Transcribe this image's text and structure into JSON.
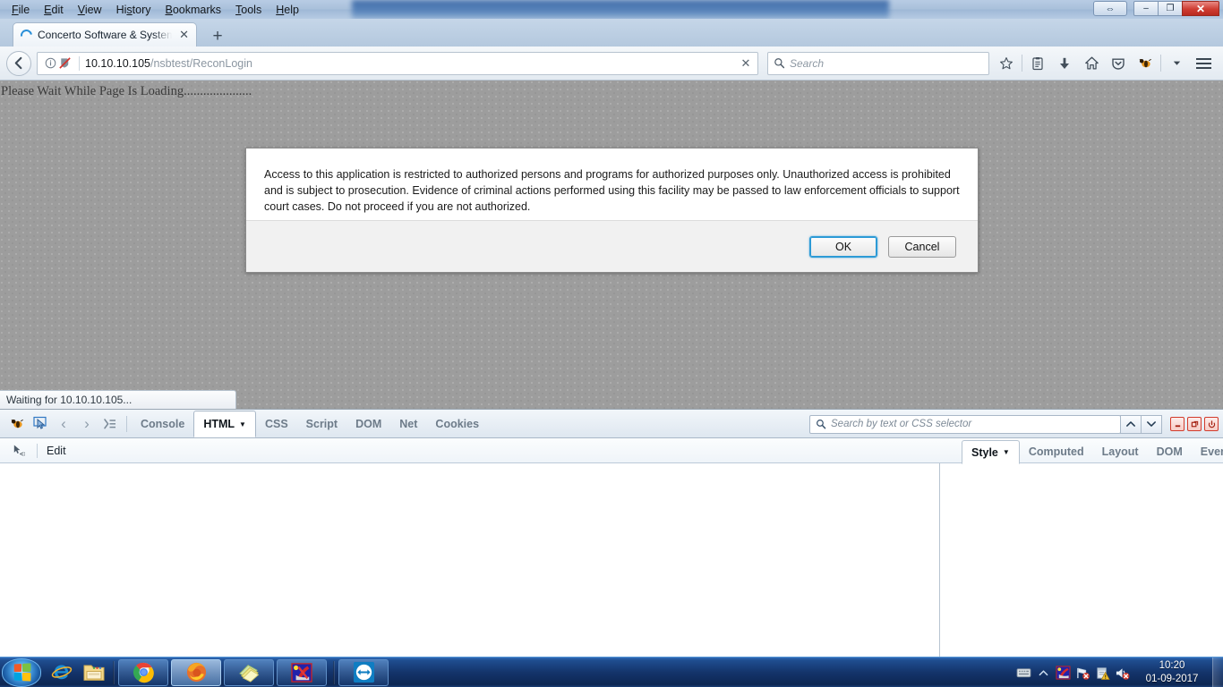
{
  "window": {
    "menus": [
      "File",
      "Edit",
      "View",
      "History",
      "Bookmarks",
      "Tools",
      "Help"
    ],
    "minimize_label": "–",
    "restore_label": "❐",
    "close_label": "✕",
    "teamviewer_label": "⇔",
    "ghost_title": ""
  },
  "tab": {
    "title": "Concerto Software & System",
    "close_label": "✕",
    "newtab_label": "+"
  },
  "navbar": {
    "back_label": "←",
    "url_host": "10.10.10.105",
    "url_path": "/nsbtest/ReconLogin",
    "clear_label": "✕",
    "search_placeholder": "Search",
    "icons": [
      "bookmark-star-icon",
      "reader-list-icon",
      "downloads-icon",
      "home-icon",
      "pocket-icon",
      "firebug-icon",
      "chevron-down-icon",
      "menu-hamburger-icon"
    ]
  },
  "page": {
    "loading_text": "Please Wait While Page Is Loading.....................",
    "status_text": "Waiting for 10.10.10.105..."
  },
  "dialog": {
    "message": "Access to this application is restricted to authorized persons and programs for authorized purposes only. Unauthorized access is prohibited and is subject to prosecution. Evidence of criminal actions performed using this facility may be passed to law enforcement officials to support court cases. Do not proceed if you are not authorized.",
    "ok_label": "OK",
    "cancel_label": "Cancel"
  },
  "firebug": {
    "nav_prev": "‹",
    "nav_next": "›",
    "tabs": [
      {
        "label": "Console",
        "active": false
      },
      {
        "label": "HTML",
        "active": true
      },
      {
        "label": "CSS",
        "active": false
      },
      {
        "label": "Script",
        "active": false
      },
      {
        "label": "DOM",
        "active": false
      },
      {
        "label": "Net",
        "active": false
      },
      {
        "label": "Cookies",
        "active": false
      }
    ],
    "search_placeholder": "Search by text or CSS selector",
    "search_up": "⌃",
    "search_down": "⌄",
    "win_minimize": "–",
    "win_maximize": "❐",
    "win_close": "⏻",
    "edit_label": "Edit",
    "side_tabs": [
      {
        "label": "Style",
        "active": true
      },
      {
        "label": "Computed",
        "active": false
      },
      {
        "label": "Layout",
        "active": false
      },
      {
        "label": "DOM",
        "active": false
      },
      {
        "label": "Events",
        "active": false
      }
    ],
    "more_label": "▶"
  },
  "taskbar": {
    "start_label": "start-orb",
    "quick_launch": [
      "internet-explorer-icon",
      "windows-explorer-icon"
    ],
    "apps": [
      "google-chrome-icon",
      "firefox-icon",
      "sticky-notes-icon",
      "paint-app-icon",
      "teamviewer-icon"
    ],
    "tray_icons": [
      "keyboard-icon",
      "show-hidden-icon",
      "paint-tray-icon",
      "network-error-icon",
      "action-center-warning-icon",
      "volume-muted-icon"
    ],
    "time": "10:20",
    "date": "01-09-2017"
  },
  "colors": {
    "accent_blue": "#2c9ad6",
    "page_bg": "#9d9d9d",
    "taskbar_blue": "#14346b",
    "close_red": "#cf3d33",
    "firebug_red": "#d23b2c"
  }
}
